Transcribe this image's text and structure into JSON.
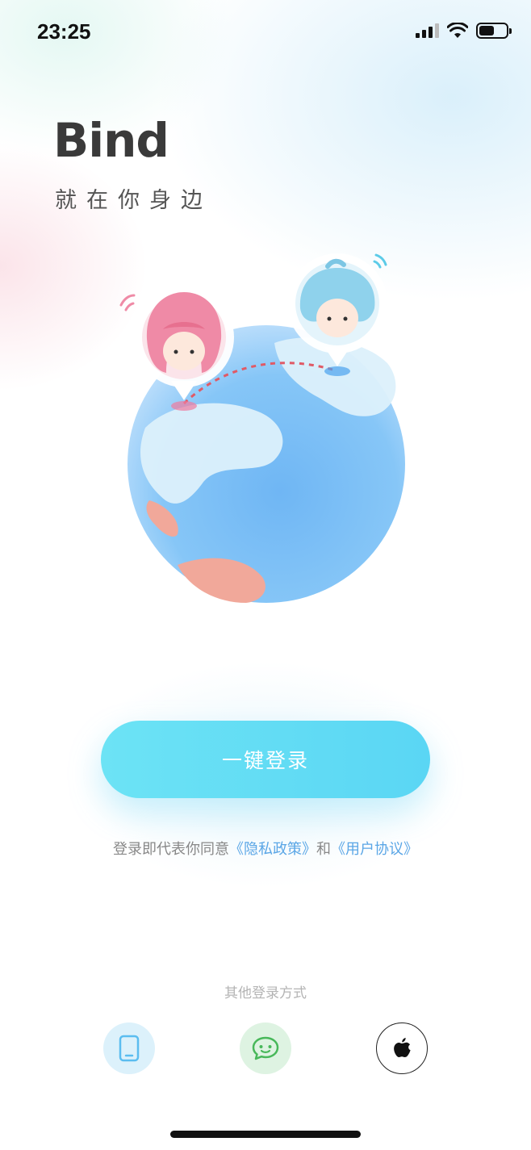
{
  "status_bar": {
    "time": "23:25",
    "battery_level": 0.55
  },
  "brand": {
    "title": "Bind",
    "slogan": "就在你身边"
  },
  "actions": {
    "one_click_login": "一键登录",
    "agreement_prefix": "登录即代表你同意",
    "privacy_policy": "《隐私政策》",
    "agreement_and": "和",
    "user_agreement": "《用户协议》",
    "other_methods_label": "其他登录方式"
  },
  "login_methods": [
    {
      "icon": "phone-icon",
      "color": "#5bbdf0"
    },
    {
      "icon": "wechat-icon",
      "color": "#48b85a"
    },
    {
      "icon": "apple-icon",
      "color": "#111111"
    }
  ],
  "colors": {
    "accent": "#62dcf5",
    "link": "#5aa6e6",
    "globe": "#7cc0f5"
  }
}
